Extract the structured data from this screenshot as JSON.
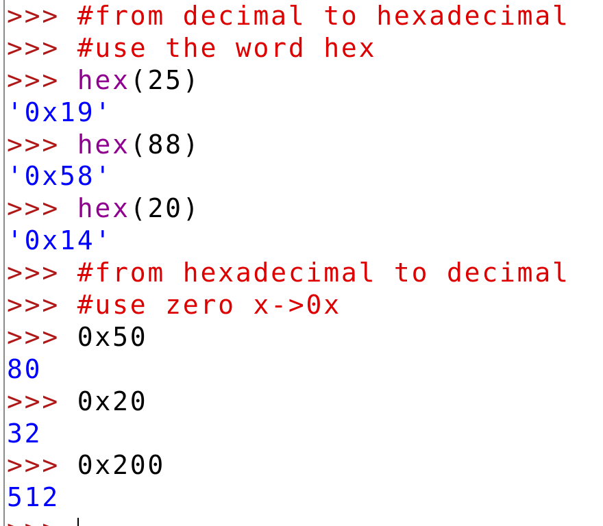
{
  "colors": {
    "prompt": "#b01818",
    "comment": "#dd0000",
    "builtin": "#900090",
    "code": "#000000",
    "output": "#0000ff"
  },
  "lines": [
    {
      "kind": "input",
      "prompt": ">>> ",
      "comment": "#from decimal to hexadecimal"
    },
    {
      "kind": "input",
      "prompt": ">>> ",
      "comment": "#use the word hex"
    },
    {
      "kind": "input",
      "prompt": ">>> ",
      "builtin": "hex",
      "args": "(25)"
    },
    {
      "kind": "output",
      "text": "'0x19'"
    },
    {
      "kind": "input",
      "prompt": ">>> ",
      "builtin": "hex",
      "args": "(88)"
    },
    {
      "kind": "output",
      "text": "'0x58'"
    },
    {
      "kind": "input",
      "prompt": ">>> ",
      "builtin": "hex",
      "args": "(20)"
    },
    {
      "kind": "output",
      "text": "'0x14'"
    },
    {
      "kind": "input",
      "prompt": ">>> ",
      "comment": "#from hexadecimal to decimal"
    },
    {
      "kind": "input",
      "prompt": ">>> ",
      "comment": "#use zero x->0x"
    },
    {
      "kind": "input",
      "prompt": ">>> ",
      "code": "0x50"
    },
    {
      "kind": "output",
      "text": "80"
    },
    {
      "kind": "input",
      "prompt": ">>> ",
      "code": "0x20"
    },
    {
      "kind": "output",
      "text": "32"
    },
    {
      "kind": "input",
      "prompt": ">>> ",
      "code": "0x200"
    },
    {
      "kind": "output",
      "text": "512"
    },
    {
      "kind": "input",
      "prompt": ">>> ",
      "code": ""
    }
  ]
}
